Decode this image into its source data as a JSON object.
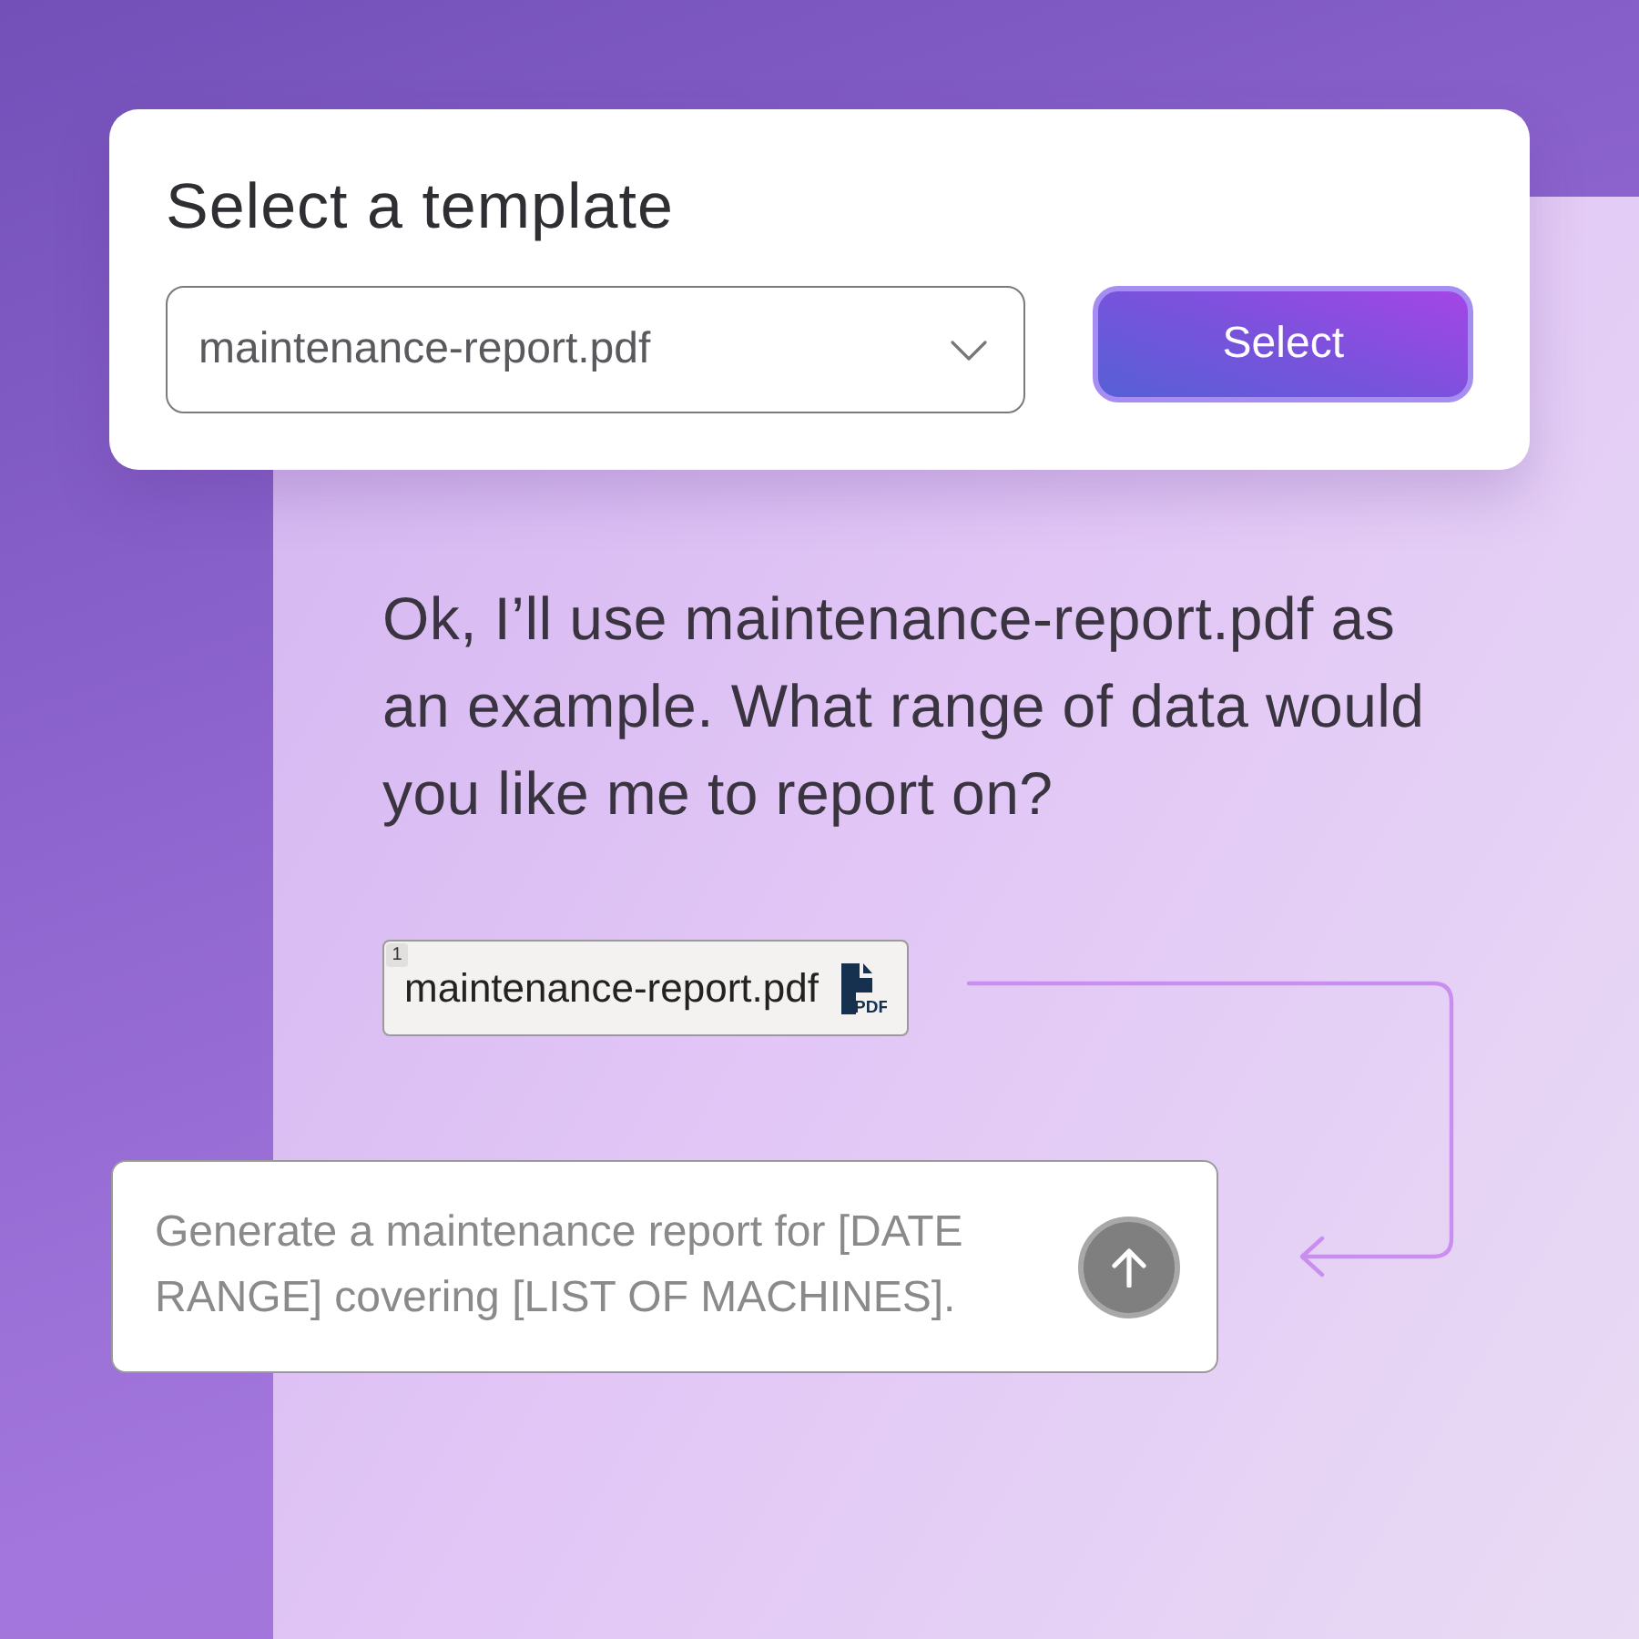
{
  "template_dialog": {
    "title": "Select a template",
    "dropdown": {
      "value": "maintenance-report.pdf"
    },
    "button": "Select"
  },
  "message": {
    "text": "Ok, I’ll use maintenance-report.pdf as an example. What range of data would you like me to report on?"
  },
  "attachment": {
    "index": "1",
    "filename": "maintenance-report.pdf",
    "icon_label": "PDF"
  },
  "prompt_input": {
    "placeholder": "Generate a maintenance report for [DATE RANGE] covering [LIST OF MACHINES]."
  }
}
